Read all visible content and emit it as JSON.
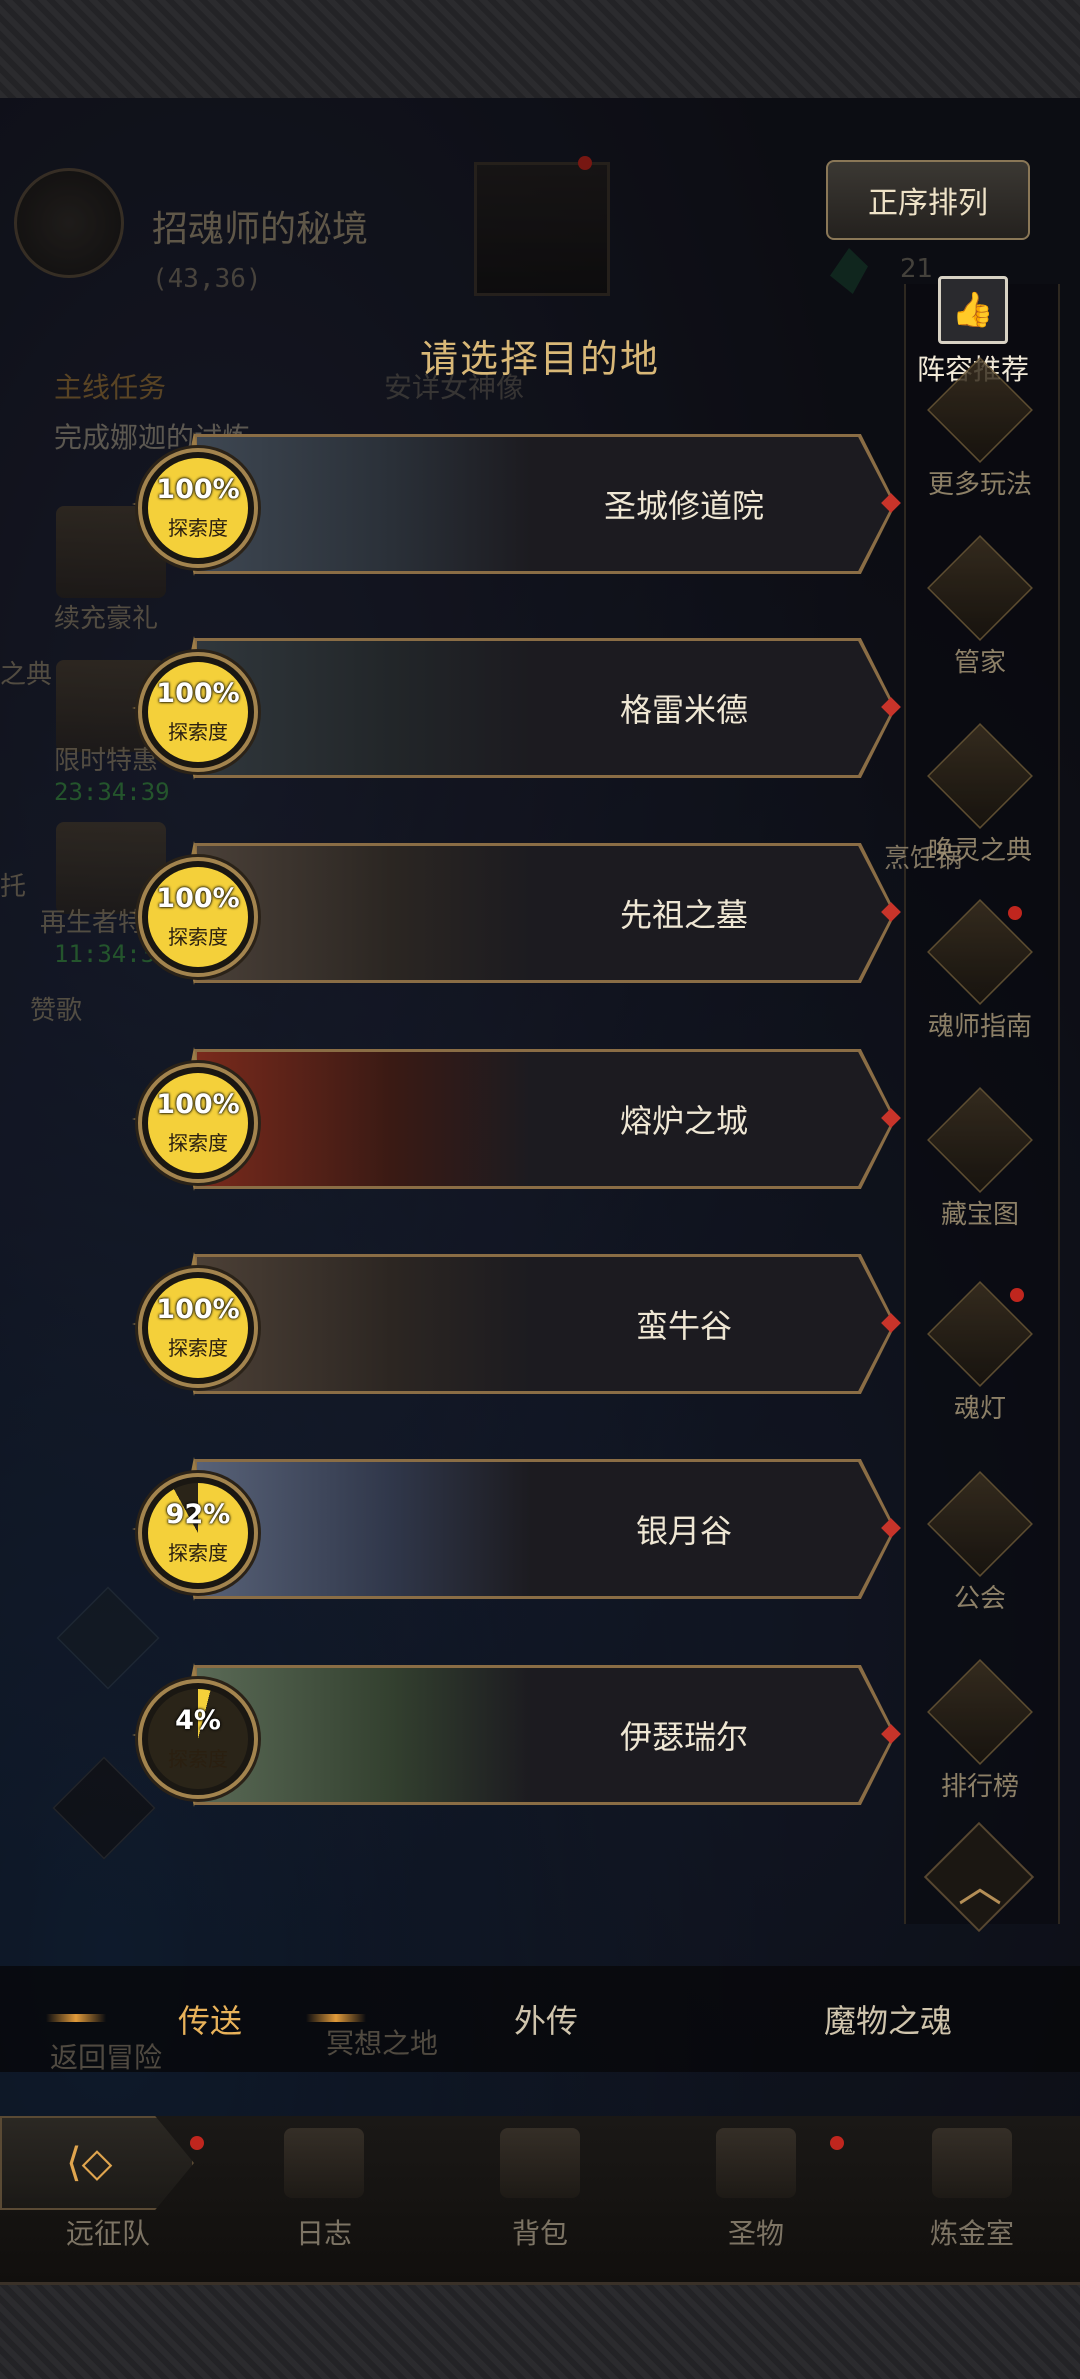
{
  "header": {
    "map_name": "招魂师的秘境",
    "coords": "(43,36)",
    "sort_button": "正序排列",
    "gem_count": "21"
  },
  "quest": {
    "label": "主线任务",
    "target": "安详女神像",
    "desc": "完成娜迦的试炼"
  },
  "title": "请选择目的地",
  "left_panel": {
    "gift_label": "续充豪礼",
    "codex_label": "之典",
    "limited_label": "限时特惠",
    "limited_timer": "23:34:39",
    "reborn_label": "再生者特惠",
    "reborn_timer": "11:34:39",
    "praise_label": "赞歌",
    "cut_label": "托"
  },
  "right_sidebar": {
    "lineup": "阵容推荐",
    "items": [
      {
        "label": "更多玩法",
        "icon": "gift-box-icon"
      },
      {
        "label": "管家",
        "icon": "steward-icon"
      },
      {
        "label": "唤灵之典",
        "icon": "spellbook-icon"
      },
      {
        "label": "魂师指南",
        "icon": "compass-icon"
      },
      {
        "label": "藏宝图",
        "icon": "treasure-map-icon"
      },
      {
        "label": "魂灯",
        "icon": "magic-lamp-icon"
      },
      {
        "label": "公会",
        "icon": "guild-icon"
      },
      {
        "label": "排行榜",
        "icon": "trophy-icon"
      }
    ],
    "behind_label": "烹饪锅"
  },
  "destinations": [
    {
      "name": "圣城修道院",
      "progress": "100%",
      "progress_value": 100,
      "progress_label": "探索度"
    },
    {
      "name": "格雷米德",
      "progress": "100%",
      "progress_value": 100,
      "progress_label": "探索度"
    },
    {
      "name": "先祖之墓",
      "progress": "100%",
      "progress_value": 100,
      "progress_label": "探索度"
    },
    {
      "name": "熔炉之城",
      "progress": "100%",
      "progress_value": 100,
      "progress_label": "探索度"
    },
    {
      "name": "蛮牛谷",
      "progress": "100%",
      "progress_value": 100,
      "progress_label": "探索度"
    },
    {
      "name": "银月谷",
      "progress": "92%",
      "progress_value": 92,
      "progress_label": "探索度"
    },
    {
      "name": "伊瑟瑞尔",
      "progress": "4%",
      "progress_value": 4,
      "progress_label": "探索度"
    }
  ],
  "tabs": [
    {
      "label": "传送",
      "active": true
    },
    {
      "label": "外传",
      "active": false
    },
    {
      "label": "魔物之魂",
      "active": false
    }
  ],
  "tabs_underlay": {
    "left": "返回冒险",
    "mid": "冥想之地"
  },
  "bottom_nav": [
    {
      "label": "远征队",
      "icon": "expedition-icon"
    },
    {
      "label": "日志",
      "icon": "journal-icon"
    },
    {
      "label": "背包",
      "icon": "backpack-icon"
    },
    {
      "label": "圣物",
      "icon": "relic-icon"
    },
    {
      "label": "炼金室",
      "icon": "alchemy-icon"
    }
  ],
  "colors": {
    "accent_gold": "#d9b877",
    "active_tab": "#e8b25a",
    "timer_green": "#3f9c4a",
    "badge_gold": "#f4d03a"
  }
}
